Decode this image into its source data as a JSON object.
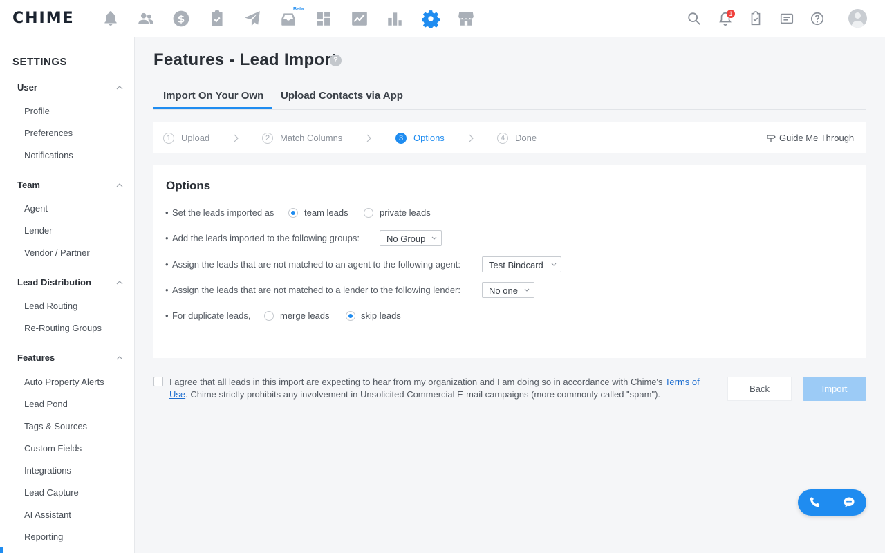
{
  "brand": {
    "logo": "CHIME"
  },
  "topnav": {
    "beta_label": "Beta",
    "notification_count": "1",
    "icons": [
      "bell-icon",
      "people-icon",
      "dollar-icon",
      "clipboard-check-icon",
      "send-icon",
      "inbox-icon",
      "dashboard-icon",
      "chart-line-icon",
      "bar-chart-icon",
      "gear-icon",
      "store-icon"
    ],
    "right_icons": [
      "search-icon",
      "notification-bell-icon",
      "task-check-icon",
      "message-icon",
      "help-icon",
      "avatar"
    ]
  },
  "sidebar": {
    "title": "SETTINGS",
    "groups": [
      {
        "label": "User",
        "items": [
          "Profile",
          "Preferences",
          "Notifications"
        ]
      },
      {
        "label": "Team",
        "items": [
          "Agent",
          "Lender",
          "Vendor / Partner"
        ]
      },
      {
        "label": "Lead Distribution",
        "items": [
          "Lead Routing",
          "Re-Routing Groups"
        ]
      },
      {
        "label": "Features",
        "items": [
          "Auto Property Alerts",
          "Lead Pond",
          "Tags & Sources",
          "Custom Fields",
          "Integrations",
          "Lead Capture",
          "AI Assistant",
          "Reporting"
        ]
      }
    ]
  },
  "page": {
    "title": "Features - Lead Import",
    "help_glyph": "?",
    "tabs": [
      "Import On Your Own",
      "Upload Contacts via App"
    ],
    "active_tab": 0
  },
  "steps": {
    "items": [
      {
        "num": "1",
        "label": "Upload"
      },
      {
        "num": "2",
        "label": "Match Columns"
      },
      {
        "num": "3",
        "label": "Options"
      },
      {
        "num": "4",
        "label": "Done"
      }
    ],
    "active_step": 2,
    "guide_label": "Guide Me Through"
  },
  "options": {
    "title": "Options",
    "rows": {
      "imported_as": {
        "label": "Set the leads imported as",
        "choices": [
          "team leads",
          "private leads"
        ],
        "selected": "team leads"
      },
      "groups": {
        "label": "Add the leads imported to the following groups:",
        "value": "No Group"
      },
      "agent": {
        "label": "Assign the leads that are not matched to an agent to the following agent:",
        "value": "Test Bindcard"
      },
      "lender": {
        "label": "Assign the leads that are not matched to a lender to the following lender:",
        "value": "No one"
      },
      "duplicates": {
        "label": "For duplicate leads,",
        "choices": [
          "merge leads",
          "skip leads"
        ],
        "selected": "skip leads"
      }
    }
  },
  "agreement": {
    "text_before": "I agree that all leads in this import are expecting to hear from my organization and I am doing so in accordance with Chime's ",
    "link": "Terms of Use",
    "text_after": ". Chime strictly prohibits any involvement in Unsolicited Commercial E-mail campaigns (more commonly called \"spam\").",
    "checked": false
  },
  "actions": {
    "back": "Back",
    "import": "Import"
  },
  "colors": {
    "accent": "#1f8cf0",
    "import_disabled": "#9ccbf6"
  }
}
